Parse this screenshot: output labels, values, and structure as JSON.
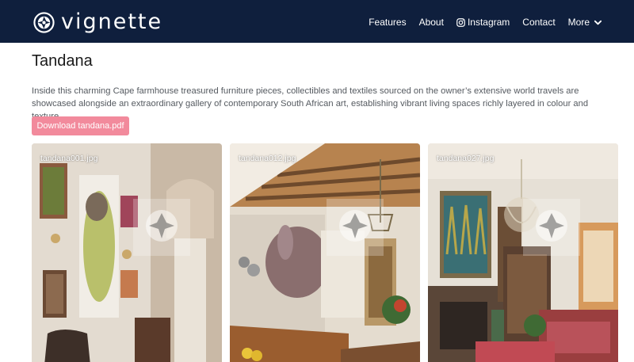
{
  "brand": {
    "name": "vignette"
  },
  "nav": {
    "features": "Features",
    "about": "About",
    "instagram": "Instagram",
    "contact": "Contact",
    "more": "More"
  },
  "page": {
    "title": "Tandana",
    "description": "Inside this charming Cape farmhouse treasured furniture pieces, collectibles and textiles sourced on the owner’s extensive world travels are showcased alongside an extraordinary gallery of contemporary South African art, establishing vibrant living spaces richly layered in colour and texture.",
    "download_label": "Download tandana.pdf"
  },
  "gallery": [
    {
      "caption": "tandana001.jpg"
    },
    {
      "caption": "tandana012.jpg"
    },
    {
      "caption": "tandana027.jpg"
    }
  ],
  "colors": {
    "navbar": "#0f1f3d",
    "download_button": "#f28a9c"
  },
  "icons": [
    "aperture-logo-icon",
    "instagram-icon",
    "chevron-down-icon",
    "watermark-aperture-icon"
  ]
}
